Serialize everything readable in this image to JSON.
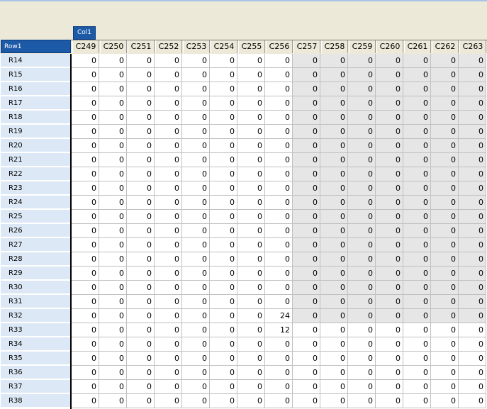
{
  "fields": {
    "column_field": "Col1",
    "row_field": "Row1"
  },
  "columns": [
    "C249",
    "C250",
    "C251",
    "C252",
    "C253",
    "C254",
    "C255",
    "C256",
    "C257",
    "C258",
    "C259",
    "C260",
    "C261",
    "C262",
    "C263"
  ],
  "rows": [
    {
      "label": "R14",
      "values": [
        0,
        0,
        0,
        0,
        0,
        0,
        0,
        0,
        0,
        0,
        0,
        0,
        0,
        0,
        0
      ]
    },
    {
      "label": "R15",
      "values": [
        0,
        0,
        0,
        0,
        0,
        0,
        0,
        0,
        0,
        0,
        0,
        0,
        0,
        0,
        0
      ]
    },
    {
      "label": "R16",
      "values": [
        0,
        0,
        0,
        0,
        0,
        0,
        0,
        0,
        0,
        0,
        0,
        0,
        0,
        0,
        0
      ]
    },
    {
      "label": "R17",
      "values": [
        0,
        0,
        0,
        0,
        0,
        0,
        0,
        0,
        0,
        0,
        0,
        0,
        0,
        0,
        0
      ]
    },
    {
      "label": "R18",
      "values": [
        0,
        0,
        0,
        0,
        0,
        0,
        0,
        0,
        0,
        0,
        0,
        0,
        0,
        0,
        0
      ]
    },
    {
      "label": "R19",
      "values": [
        0,
        0,
        0,
        0,
        0,
        0,
        0,
        0,
        0,
        0,
        0,
        0,
        0,
        0,
        0
      ]
    },
    {
      "label": "R20",
      "values": [
        0,
        0,
        0,
        0,
        0,
        0,
        0,
        0,
        0,
        0,
        0,
        0,
        0,
        0,
        0
      ]
    },
    {
      "label": "R21",
      "values": [
        0,
        0,
        0,
        0,
        0,
        0,
        0,
        0,
        0,
        0,
        0,
        0,
        0,
        0,
        0
      ]
    },
    {
      "label": "R22",
      "values": [
        0,
        0,
        0,
        0,
        0,
        0,
        0,
        0,
        0,
        0,
        0,
        0,
        0,
        0,
        0
      ]
    },
    {
      "label": "R23",
      "values": [
        0,
        0,
        0,
        0,
        0,
        0,
        0,
        0,
        0,
        0,
        0,
        0,
        0,
        0,
        0
      ]
    },
    {
      "label": "R24",
      "values": [
        0,
        0,
        0,
        0,
        0,
        0,
        0,
        0,
        0,
        0,
        0,
        0,
        0,
        0,
        0
      ]
    },
    {
      "label": "R25",
      "values": [
        0,
        0,
        0,
        0,
        0,
        0,
        0,
        0,
        0,
        0,
        0,
        0,
        0,
        0,
        0
      ]
    },
    {
      "label": "R26",
      "values": [
        0,
        0,
        0,
        0,
        0,
        0,
        0,
        0,
        0,
        0,
        0,
        0,
        0,
        0,
        0
      ]
    },
    {
      "label": "R27",
      "values": [
        0,
        0,
        0,
        0,
        0,
        0,
        0,
        0,
        0,
        0,
        0,
        0,
        0,
        0,
        0
      ]
    },
    {
      "label": "R28",
      "values": [
        0,
        0,
        0,
        0,
        0,
        0,
        0,
        0,
        0,
        0,
        0,
        0,
        0,
        0,
        0
      ]
    },
    {
      "label": "R29",
      "values": [
        0,
        0,
        0,
        0,
        0,
        0,
        0,
        0,
        0,
        0,
        0,
        0,
        0,
        0,
        0
      ]
    },
    {
      "label": "R30",
      "values": [
        0,
        0,
        0,
        0,
        0,
        0,
        0,
        0,
        0,
        0,
        0,
        0,
        0,
        0,
        0
      ]
    },
    {
      "label": "R31",
      "values": [
        0,
        0,
        0,
        0,
        0,
        0,
        0,
        0,
        0,
        0,
        0,
        0,
        0,
        0,
        0
      ]
    },
    {
      "label": "R32",
      "values": [
        0,
        0,
        0,
        0,
        0,
        0,
        0,
        24,
        0,
        0,
        0,
        0,
        0,
        0,
        0
      ]
    },
    {
      "label": "R33",
      "values": [
        0,
        0,
        0,
        0,
        0,
        0,
        0,
        12,
        0,
        0,
        0,
        0,
        0,
        0,
        0
      ]
    },
    {
      "label": "R34",
      "values": [
        0,
        0,
        0,
        0,
        0,
        0,
        0,
        0,
        0,
        0,
        0,
        0,
        0,
        0,
        0
      ]
    },
    {
      "label": "R35",
      "values": [
        0,
        0,
        0,
        0,
        0,
        0,
        0,
        0,
        0,
        0,
        0,
        0,
        0,
        0,
        0
      ]
    },
    {
      "label": "R36",
      "values": [
        0,
        0,
        0,
        0,
        0,
        0,
        0,
        0,
        0,
        0,
        0,
        0,
        0,
        0,
        0
      ]
    },
    {
      "label": "R37",
      "values": [
        0,
        0,
        0,
        0,
        0,
        0,
        0,
        0,
        0,
        0,
        0,
        0,
        0,
        0,
        0
      ]
    },
    {
      "label": "R38",
      "values": [
        0,
        0,
        0,
        0,
        0,
        0,
        0,
        0,
        0,
        0,
        0,
        0,
        0,
        0,
        0
      ]
    }
  ],
  "highlight": {
    "first_col": "C257",
    "first_row": "R14",
    "last_row": "R32",
    "color": "#e6e6e6"
  }
}
